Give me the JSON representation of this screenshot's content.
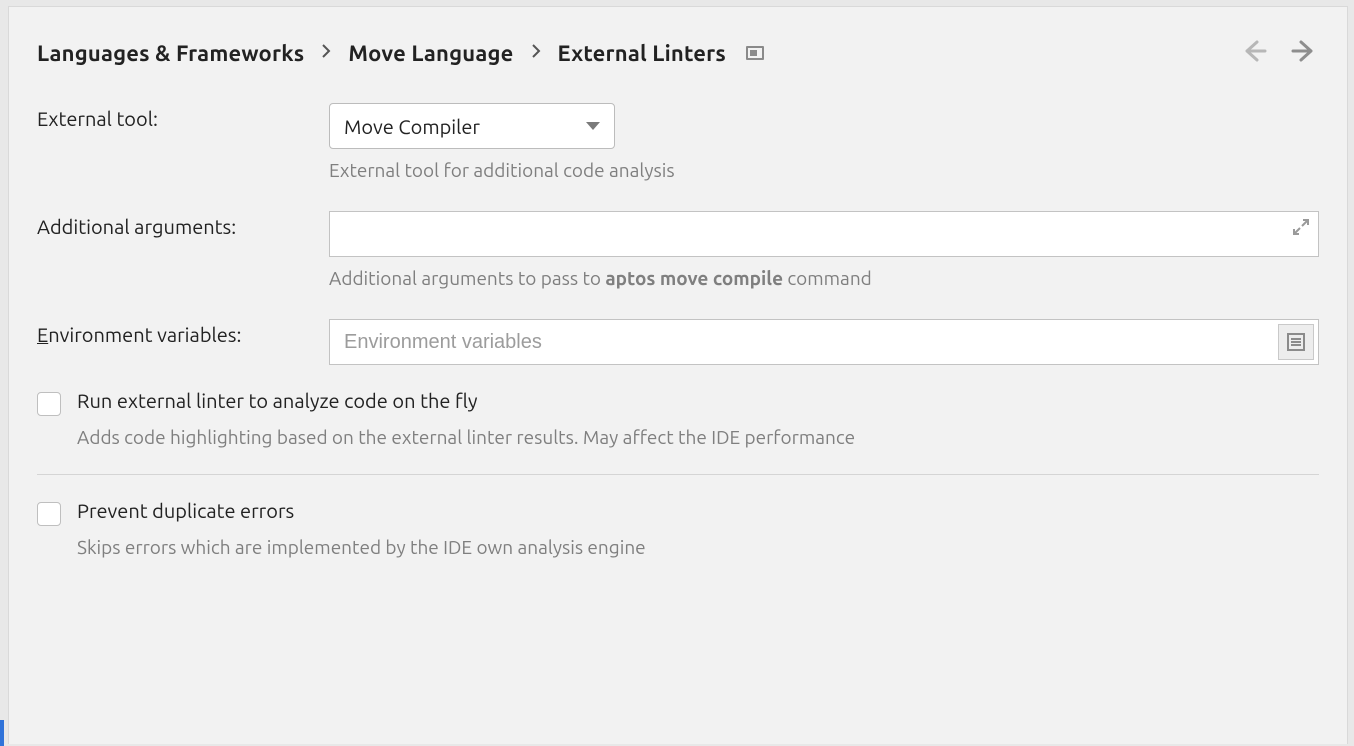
{
  "breadcrumb": {
    "root": "Languages & Frameworks",
    "mid": "Move Language",
    "leaf": "External Linters"
  },
  "nav": {
    "back_enabled": false,
    "fwd_enabled": true
  },
  "form": {
    "tool_label": "External tool:",
    "tool_value": "Move Compiler",
    "tool_hint": "External tool for additional code analysis",
    "args_label": "Additional arguments:",
    "args_value": "",
    "args_hint_prefix": "Additional arguments to pass to ",
    "args_hint_strong": "aptos move compile",
    "args_hint_suffix": " command",
    "env_label_prefix": "E",
    "env_label_rest": "nvironment variables:",
    "env_value": "",
    "env_placeholder": "Environment variables",
    "onfly_label": "Run external linter to analyze code on the fly",
    "onfly_hint": "Adds code highlighting based on the external linter results. May affect the IDE performance",
    "dup_label": "Prevent duplicate errors",
    "dup_hint": "Skips errors which are implemented by the IDE own analysis engine"
  }
}
